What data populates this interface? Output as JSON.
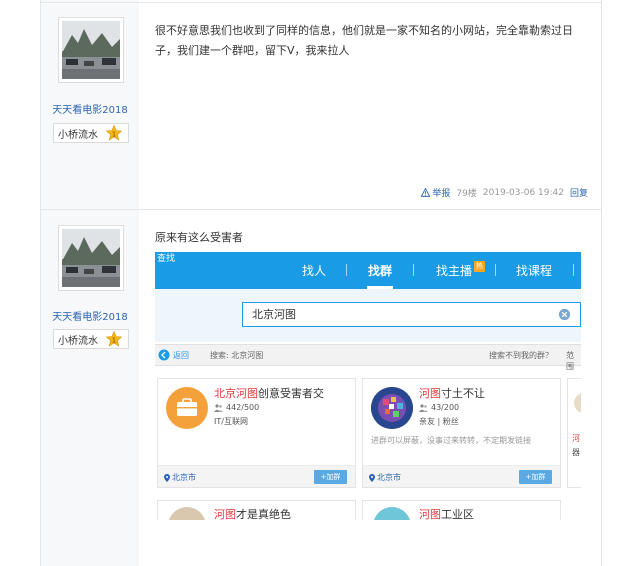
{
  "posts": [
    {
      "username": "天天看电影2018",
      "level_name": "小桥流水",
      "level_number": "1",
      "text": "很不好意思我们也收到了同样的信息，他们就是一家不知名的小网站，完全靠勒索过日子，我们建一个群吧，留下V，我来拉人",
      "report_label": "举报",
      "floor": "79楼",
      "timestamp": "2019-03-06 19:42",
      "reply_label": "回复"
    },
    {
      "username": "天天看电影2018",
      "level_name": "小桥流水",
      "level_number": "1",
      "text": "原来有这么受害者"
    }
  ],
  "embedded_screenshot": {
    "corner_text": "查找",
    "nav": {
      "items": [
        "找人",
        "找群",
        "找主播",
        "找课程"
      ],
      "active_index": 1,
      "hot_badge": "热"
    },
    "search_value": "北京河图",
    "filter_bar": {
      "back_label": "返回",
      "search_label": "搜索: 北京河图",
      "hint": "搜索不到我的群？",
      "range": "范围"
    },
    "cards": [
      {
        "title_highlight": "北京河图",
        "title_rest": "创意受害者交",
        "members": "442/500",
        "tags": "IT/互联网",
        "description": "",
        "location": "北京市",
        "join_label": "+加群",
        "avatar_color": "#f4a13b"
      },
      {
        "title_highlight": "河图",
        "title_rest": "寸土不让",
        "members": "43/200",
        "tags": "亲友 | 粉丝",
        "description": "进群可以屏蔽，没事过来转转，不定期发链接",
        "location": "北京市",
        "join_label": "+加群",
        "avatar_color": "#3a5aa8"
      }
    ],
    "partial_cards": [
      {
        "title_highlight": "河图",
        "title_rest": "才是真绝色"
      },
      {
        "title_highlight": "河图",
        "title_rest": "工业区"
      }
    ],
    "right_edge_fragments": [
      "河",
      "器"
    ]
  },
  "colors": {
    "link_blue": "#2d64b3",
    "nav_blue": "#1a9be6",
    "highlight_red": "#e0393e",
    "level_gold": "#f5b61a"
  }
}
